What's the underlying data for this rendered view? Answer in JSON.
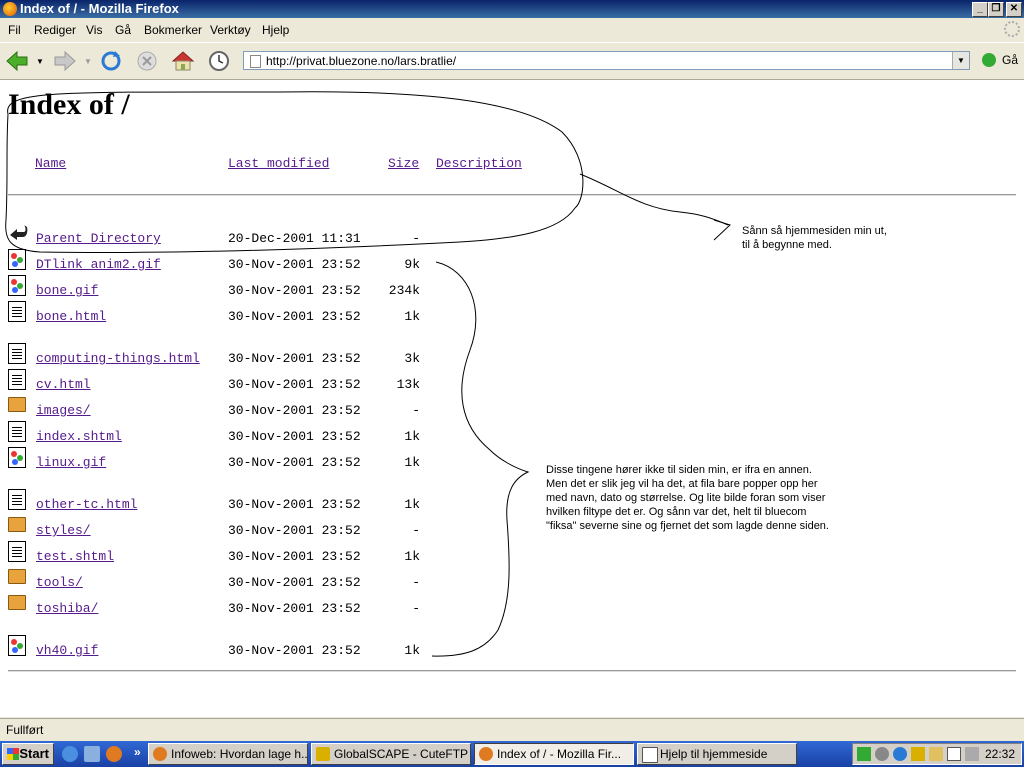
{
  "window": {
    "title": "Index of / - Mozilla Firefox",
    "controls": {
      "minimize": "_",
      "restore": "❐",
      "close": "✕"
    }
  },
  "menu": [
    "Fil",
    "Rediger",
    "Vis",
    "Gå",
    "Bokmerker",
    "Verktøy",
    "Hjelp"
  ],
  "nav": {
    "url": "http://privat.bluezone.no/lars.bratlie/",
    "go_label": "Gå",
    "icons": [
      "back-icon",
      "forward-icon",
      "reload-icon",
      "stop-icon",
      "home-icon",
      "history-icon"
    ]
  },
  "page": {
    "title": "Index of /",
    "columns": {
      "name": "Name",
      "modified": "Last modified",
      "size": "Size",
      "description": "Description"
    },
    "rows": [
      {
        "icon": "back",
        "name": "Parent Directory",
        "modified": "20-Dec-2001 11:31",
        "size": "-"
      },
      {
        "icon": "image",
        "name": "DTlink anim2.gif",
        "modified": "30-Nov-2001 23:52",
        "size": "9k"
      },
      {
        "icon": "image",
        "name": "bone.gif",
        "modified": "30-Nov-2001 23:52",
        "size": "234k"
      },
      {
        "icon": "file",
        "name": "bone.html",
        "modified": "30-Nov-2001 23:52",
        "size": "1k"
      },
      {
        "icon": "file",
        "name": "computing-things.html",
        "modified": "30-Nov-2001 23:52",
        "size": "3k"
      },
      {
        "icon": "file",
        "name": "cv.html",
        "modified": "30-Nov-2001 23:52",
        "size": "13k"
      },
      {
        "icon": "folder",
        "name": "images/",
        "modified": "30-Nov-2001 23:52",
        "size": "-"
      },
      {
        "icon": "file",
        "name": "index.shtml",
        "modified": "30-Nov-2001 23:52",
        "size": "1k"
      },
      {
        "icon": "image",
        "name": "linux.gif",
        "modified": "30-Nov-2001 23:52",
        "size": "1k"
      },
      {
        "icon": "file",
        "name": "other-tc.html",
        "modified": "30-Nov-2001 23:52",
        "size": "1k"
      },
      {
        "icon": "folder",
        "name": "styles/",
        "modified": "30-Nov-2001 23:52",
        "size": "-"
      },
      {
        "icon": "file",
        "name": "test.shtml",
        "modified": "30-Nov-2001 23:52",
        "size": "1k"
      },
      {
        "icon": "folder",
        "name": "tools/",
        "modified": "30-Nov-2001 23:52",
        "size": "-"
      },
      {
        "icon": "folder",
        "name": "toshiba/",
        "modified": "30-Nov-2001 23:52",
        "size": "-"
      },
      {
        "icon": "image",
        "name": "vh40.gif",
        "modified": "30-Nov-2001 23:52",
        "size": "1k"
      }
    ]
  },
  "annotations": {
    "top": "Sånn så hjemmesiden min ut,\ntil å begynne med.",
    "right": "Disse tingene hører ikke til siden min, er ifra en annen.\nMen det er slik jeg vil ha det, at fila bare popper opp her\nmed navn, dato og størrelse. Og lite bilde foran som viser\nhvilken filtype det er. Og sånn var det, helt til bluecom\n\"fiksa\" severne sine og fjernet det som lagde denne siden."
  },
  "status": "Fullført",
  "taskbar": {
    "start": "Start",
    "overflow": "»",
    "tasks": [
      {
        "label": "Infoweb: Hvordan lage h...",
        "active": false
      },
      {
        "label": "GlobalSCAPE - CuteFTP ...",
        "active": false
      },
      {
        "label": "Index of / - Mozilla Fir...",
        "active": true
      },
      {
        "label": "Hjelp til hjemmeside",
        "active": false
      }
    ],
    "clock": "22:32"
  },
  "colors": {
    "link": "#551a8b",
    "titlebar": "#0a246a",
    "taskbar": "#245edb"
  }
}
